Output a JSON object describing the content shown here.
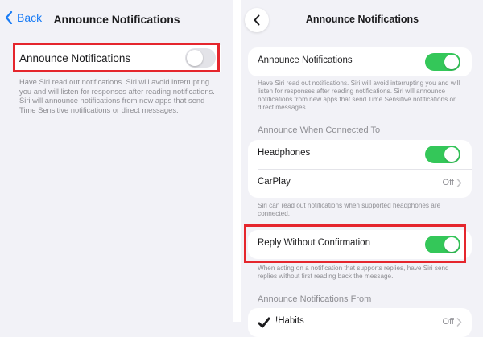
{
  "left": {
    "back_label": "Back",
    "title": "Announce Notifications",
    "toggle_label": "Announce Notifications",
    "toggle_on": false,
    "description": "Have Siri read out notifications. Siri will avoid interrupting you and will listen for responses after reading notifications. Siri will announce notifications from new apps that send Time Sensitive notifications or direct messages."
  },
  "right": {
    "title": "Announce Notifications",
    "main_toggle_label": "Announce Notifications",
    "main_description": "Have Siri read out notifications. Siri will avoid interrupting you and will listen for responses after reading notifications. Siri will announce notifications from new apps that send Time Sensitive notifications or direct messages.",
    "connected_header": "Announce When Connected To",
    "headphones_label": "Headphones",
    "carplay_label": "CarPlay",
    "carplay_value": "Off",
    "connected_description": "Siri can read out notifications when supported headphones are connected.",
    "reply_label": "Reply Without Confirmation",
    "reply_description": "When acting on a notification that supports replies, have Siri send replies without first reading back the message.",
    "from_header": "Announce Notifications From",
    "app_label": "!Habits",
    "app_value": "Off"
  },
  "colors": {
    "accent": "#1a7cf5",
    "toggle_on": "#34c759",
    "highlight": "#e5262d"
  }
}
